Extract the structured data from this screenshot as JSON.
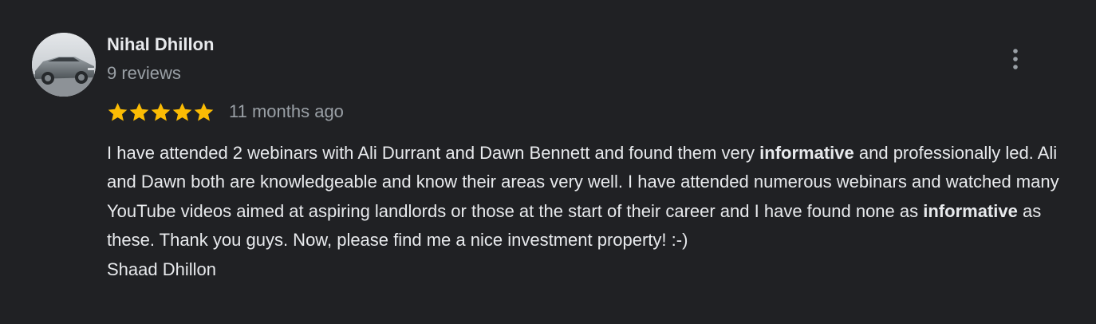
{
  "reviewer": {
    "name": "Nihal Dhillon",
    "meta": "9 reviews",
    "avatar_icon": "car-photo-avatar"
  },
  "menu": {
    "icon": "more-vert-icon"
  },
  "rating": {
    "stars": 5,
    "max_stars": 5,
    "star_color": "#fbbc04",
    "time_ago": "11 months ago"
  },
  "review": {
    "segments": [
      "I have attended 2 webinars with Ali Durrant and Dawn Bennett and found them very ",
      "informative",
      " and professionally led. Ali and Dawn both are knowledgeable and know their areas very well. I have attended numerous webinars and watched many YouTube videos aimed at aspiring landlords or those at the start of their career and I have found none as ",
      "informative",
      " as these. Thank you guys. Now, please find me a nice investment property! :-)"
    ],
    "signature": "Shaad Dhillon"
  },
  "colors": {
    "background": "#202124",
    "text_primary": "#e8eaed",
    "text_secondary": "#9aa0a6",
    "star": "#fbbc04"
  }
}
